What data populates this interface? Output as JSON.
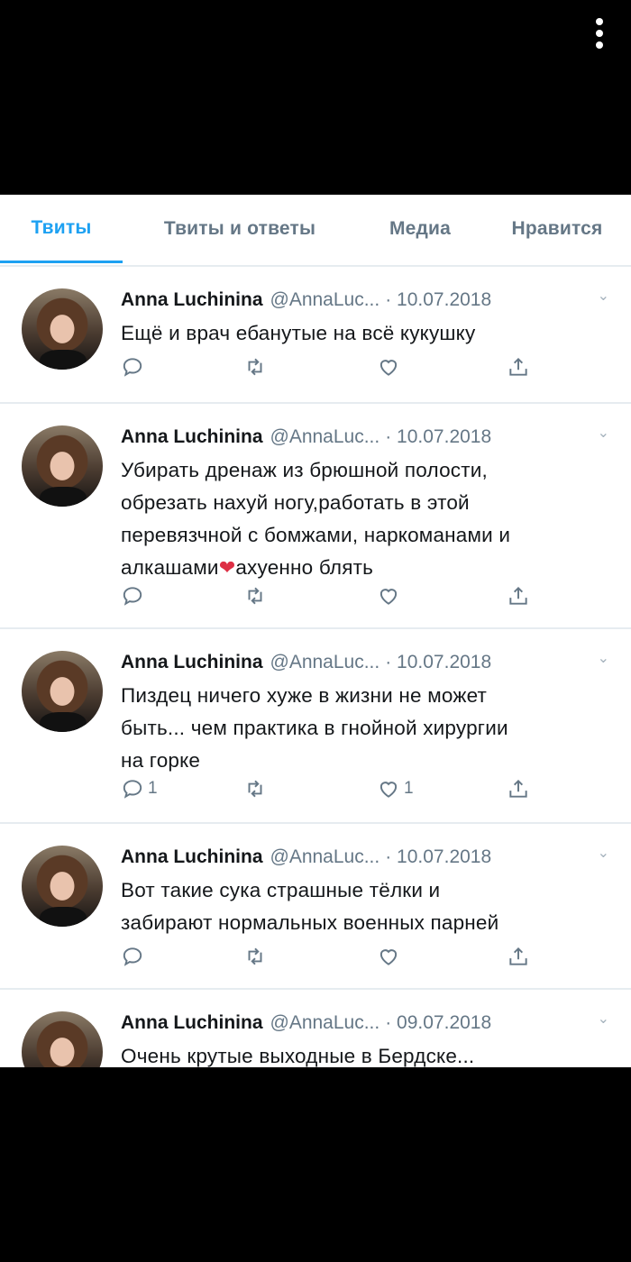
{
  "tabs": [
    "Твиты",
    "Твиты и ответы",
    "Медиа",
    "Нравится"
  ],
  "tweets": [
    {
      "name": "Anna Luchinina",
      "handle": "@AnnaLuc...",
      "date": "· 10.07.2018",
      "lines": [
        "Ещё и врач ебанутые на всё кукушку"
      ],
      "reply_count": "",
      "like_count": ""
    },
    {
      "name": "Anna Luchinina",
      "handle": "@AnnaLuc...",
      "date": "· 10.07.2018",
      "lines": [
        "Убирать дренаж из брюшной полости,",
        "обрезать нахуй ногу,работать в этой",
        "перевязчной с бомжами, наркоманами и",
        "алкашами"
      ],
      "emoji": "❤",
      "tail": "ахуенно блять",
      "reply_count": "",
      "like_count": ""
    },
    {
      "name": "Anna Luchinina",
      "handle": "@AnnaLuc...",
      "date": "· 10.07.2018",
      "lines": [
        "Пиздец ничего хуже в жизни не может",
        "быть... чем практика в гнойной хирургии",
        "на горке"
      ],
      "reply_count": "1",
      "like_count": "1"
    },
    {
      "name": "Anna Luchinina",
      "handle": "@AnnaLuc...",
      "date": "· 10.07.2018",
      "lines": [
        "Вот такие сука страшные тёлки и",
        "забирают нормальных военных парней"
      ],
      "reply_count": "",
      "like_count": ""
    },
    {
      "name": "Anna Luchinina",
      "handle": "@AnnaLuc...",
      "date": "· 09.07.2018",
      "lines": [
        "Очень крутые выходные в Бердске..."
      ],
      "reply_count": "",
      "like_count": ""
    }
  ]
}
